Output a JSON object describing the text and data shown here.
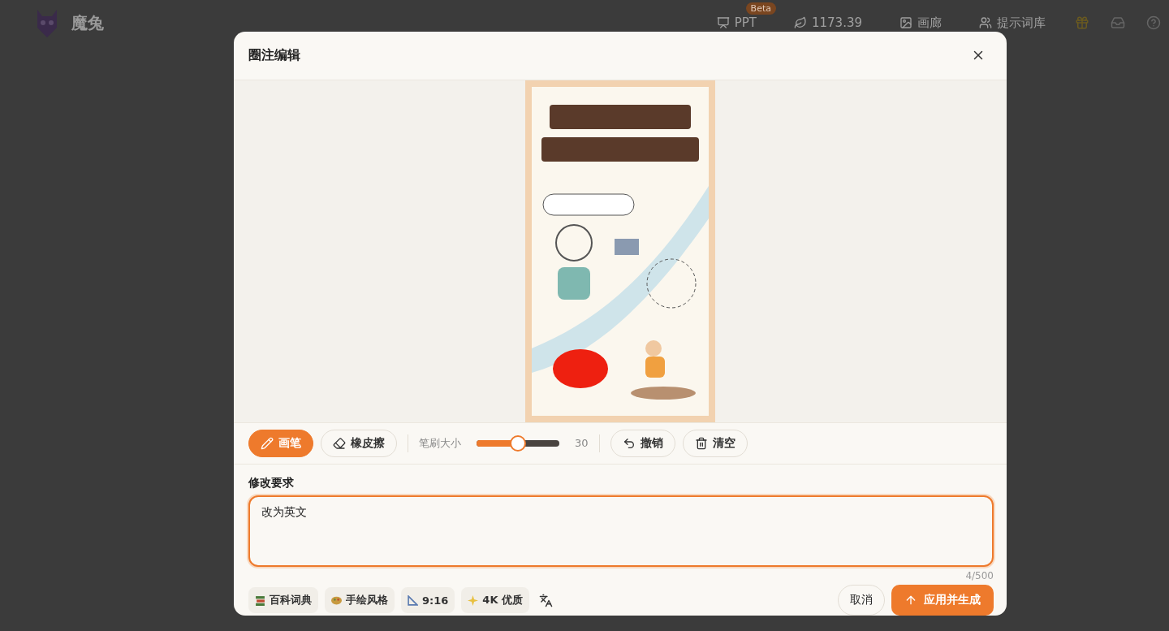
{
  "header": {
    "brand": "魔兔",
    "nav": [
      {
        "kind": "ppt",
        "label": "PPT",
        "badge": "Beta"
      },
      {
        "kind": "credits",
        "label": "1173.39"
      },
      {
        "kind": "gallery",
        "label": "画廊"
      },
      {
        "kind": "prompts",
        "label": "提示词库"
      }
    ]
  },
  "dialog": {
    "title": "圈注编辑",
    "toolbar": {
      "tools": [
        {
          "kind": "pen",
          "label": "画笔",
          "selected": true
        },
        {
          "kind": "eraser",
          "label": "橡皮擦",
          "selected": false
        }
      ],
      "brush": {
        "label": "笔刷大小",
        "level": 0.5,
        "reading": "30"
      },
      "actions": [
        {
          "kind": "undo",
          "label": "撤销"
        },
        {
          "kind": "clear",
          "label": "清空"
        }
      ]
    },
    "request": {
      "label": "修改要求",
      "value": "改为英文",
      "counter": "4/500"
    },
    "chips": [
      {
        "kind": "books",
        "label": "百科词典"
      },
      {
        "kind": "palette",
        "label": "手绘风格"
      },
      {
        "kind": "ruler",
        "label": "9:16"
      },
      {
        "kind": "sparkle",
        "label": "4K 优质"
      }
    ],
    "cancel": "取消",
    "submit": "应用并生成"
  }
}
